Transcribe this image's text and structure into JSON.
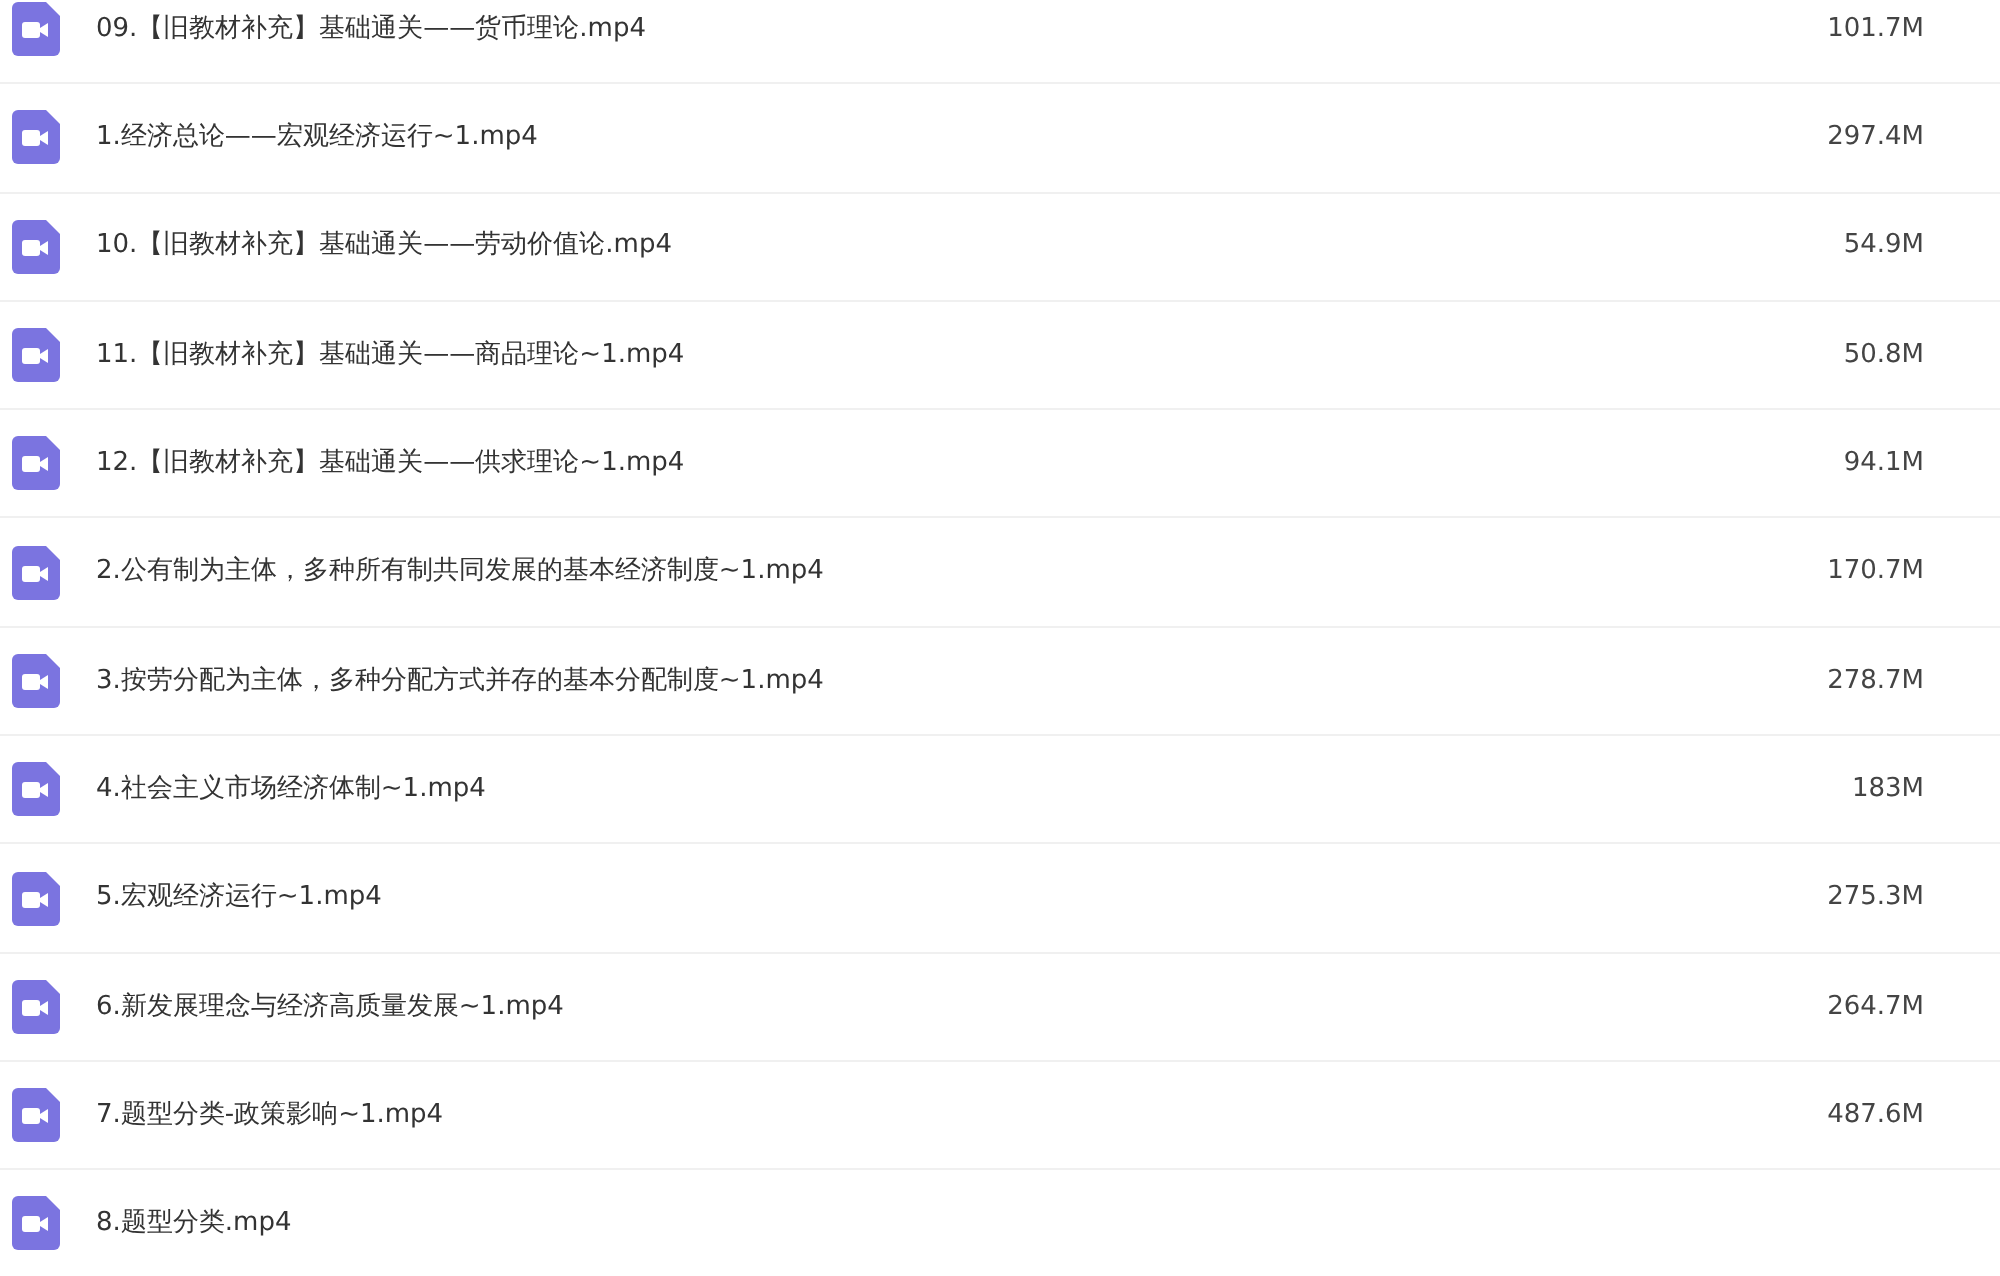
{
  "files": [
    {
      "name": "09.【旧教材补充】基础通关——货币理论.mp4",
      "size": "101.7M"
    },
    {
      "name": "1.经济总论——宏观经济运行~1.mp4",
      "size": "297.4M"
    },
    {
      "name": "10.【旧教材补充】基础通关——劳动价值论.mp4",
      "size": "54.9M"
    },
    {
      "name": "11.【旧教材补充】基础通关——商品理论~1.mp4",
      "size": "50.8M"
    },
    {
      "name": "12.【旧教材补充】基础通关——供求理论~1.mp4",
      "size": "94.1M"
    },
    {
      "name": "2.公有制为主体，多种所有制共同发展的基本经济制度~1.mp4",
      "size": "170.7M"
    },
    {
      "name": "3.按劳分配为主体，多种分配方式并存的基本分配制度~1.mp4",
      "size": "278.7M"
    },
    {
      "name": "4.社会主义市场经济体制~1.mp4",
      "size": "183M"
    },
    {
      "name": "5.宏观经济运行~1.mp4",
      "size": "275.3M"
    },
    {
      "name": "6.新发展理念与经济高质量发展~1.mp4",
      "size": "264.7M"
    },
    {
      "name": "7.题型分类-政策影响~1.mp4",
      "size": "487.6M"
    },
    {
      "name": "8.题型分类.mp4"
    }
  ]
}
